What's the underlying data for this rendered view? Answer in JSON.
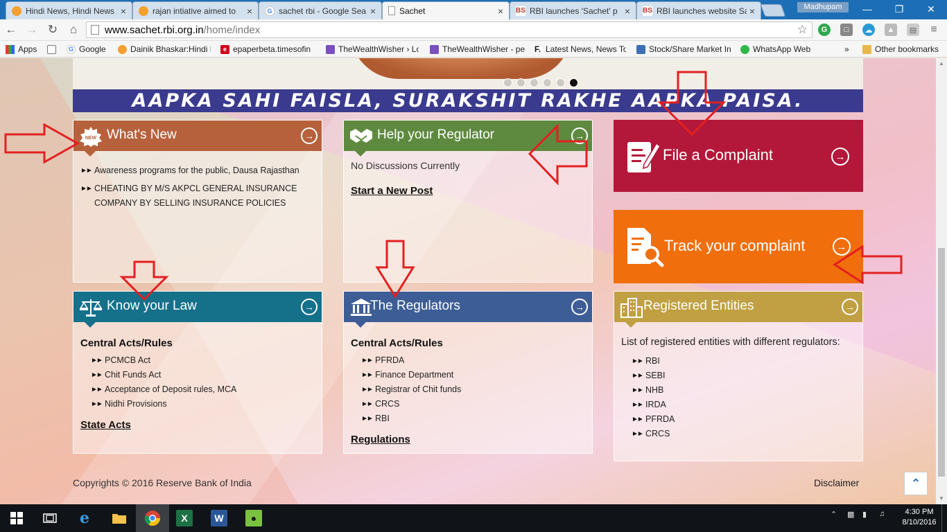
{
  "browser": {
    "tabs": [
      {
        "title": "Hindi News, Hindi News",
        "icon": "orange-circle-icon",
        "color": "#f4a030"
      },
      {
        "title": "rajan intiative aimed to",
        "icon": "orange-circle-icon",
        "color": "#f4a030"
      },
      {
        "title": "sachet rbi - Google Sea",
        "icon": "google-icon",
        "color": "#4285f4"
      },
      {
        "title": "Sachet",
        "icon": "page-icon",
        "color": "#888888"
      },
      {
        "title": "RBI launches 'Sachet' p",
        "icon": "bs-icon",
        "color": "#c0392b",
        "icon_text": "BS"
      },
      {
        "title": "RBI launches website Sa",
        "icon": "bs-icon",
        "color": "#c0392b",
        "icon_text": "BS"
      }
    ],
    "user": "Madhupam",
    "url_host": "www.sachet.rbi.org.in",
    "url_path": "/home/index",
    "bookmarks": [
      {
        "label": "Apps"
      },
      {
        "label": ""
      },
      {
        "label": "Google"
      },
      {
        "label": "Dainik Bhaskar:Hindi N"
      },
      {
        "label": "epaperbeta.timesofin"
      },
      {
        "label": "TheWealthWisher › Lo"
      },
      {
        "label": "TheWealthWisher - pe"
      },
      {
        "label": "Latest News, News To"
      },
      {
        "label": "Stock/Share Market In"
      },
      {
        "label": "WhatsApp Web"
      }
    ],
    "bookmarks_more": "»",
    "other_bookmarks": "Other bookmarks"
  },
  "banner": {
    "tagline": "AAPKA SAHI FAISLA, SURAKSHIT RAKHE AAPKA PAISA."
  },
  "whats_new": {
    "title": "What's New",
    "badge": "NEW",
    "items": [
      "Awareness programs for the public, Dausa Rajasthan",
      "CHEATING BY M/S AKPCL GENERAL INSURANCE COMPANY BY SELLING INSURANCE POLICIES"
    ],
    "color": "#b6613c"
  },
  "help_regulator": {
    "title": "Help your Regulator",
    "status": "No Discussions Currently",
    "link": "Start a New Post",
    "color": "#5e8a3f"
  },
  "file_complaint": {
    "title": "File a Complaint",
    "color": "#b3183a"
  },
  "track_complaint": {
    "title": "Track your complaint",
    "color": "#f06e0c"
  },
  "know_law": {
    "title": "Know your Law",
    "section": "Central Acts/Rules",
    "items": [
      "PCMCB Act",
      "Chit Funds Act",
      "Acceptance of Deposit rules, MCA",
      "Nidhi Provisions"
    ],
    "link": "State Acts",
    "color": "#15708a"
  },
  "regulators": {
    "title": "The Regulators",
    "section": "Central Acts/Rules",
    "items": [
      "PFRDA",
      "Finance Department",
      "Registrar of Chit funds",
      "CRCS",
      "RBI"
    ],
    "link": "Regulations",
    "color": "#3d5d96"
  },
  "registered": {
    "title": "Registered Entities",
    "intro": "List of registered entities with different regulators:",
    "items": [
      "RBI",
      "SEBI",
      "NHB",
      "IRDA",
      "PFRDA",
      "CRCS"
    ],
    "color": "#c0a043"
  },
  "footer": {
    "copyright": "Copyrights © 2016 Reserve Bank of India",
    "disclaimer": "Disclaimer"
  },
  "taskbar": {
    "time": "4:30 PM",
    "date": "8/10/2016"
  }
}
